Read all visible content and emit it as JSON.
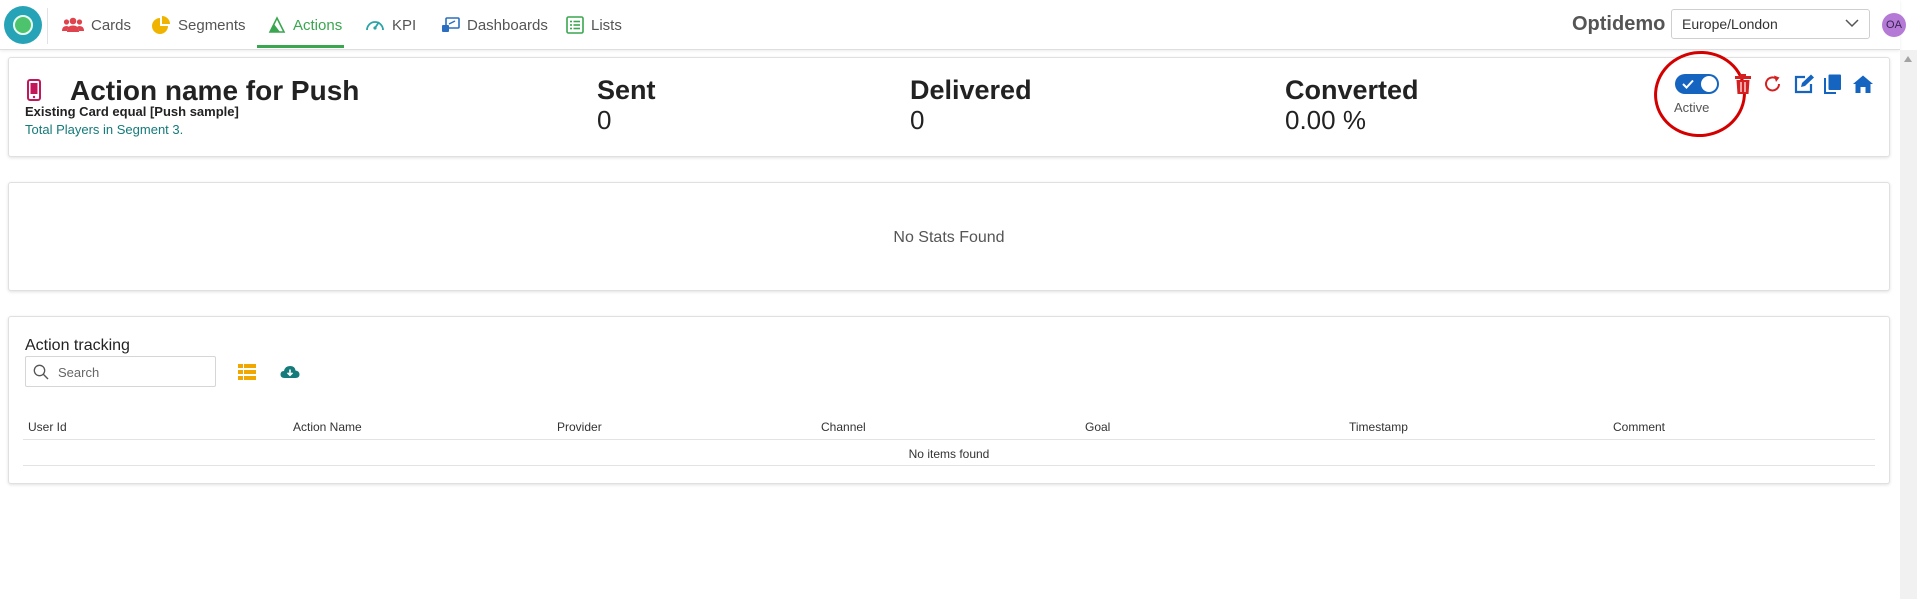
{
  "nav": {
    "items": [
      {
        "label": "Cards",
        "icon": "users-icon",
        "color": "#e0424e"
      },
      {
        "label": "Segments",
        "icon": "pie-chart-icon",
        "color": "#f0b400"
      },
      {
        "label": "Actions",
        "icon": "sail-icon",
        "color": "#3aa64f",
        "active": true
      },
      {
        "label": "KPI",
        "icon": "gauge-icon",
        "color": "#2aa4a4"
      },
      {
        "label": "Dashboards",
        "icon": "dashboard-icon",
        "color": "#2a6fbf"
      },
      {
        "label": "Lists",
        "icon": "list-icon",
        "color": "#3aa64f"
      }
    ],
    "brand": "Optidemo",
    "timezone": "Europe/London",
    "avatar_initials": "OA"
  },
  "action": {
    "title": "Action name for Push",
    "subtitle": "Existing Card equal [Push sample]",
    "segment_text": "Total Players in Segment 3.",
    "status_label": "Active",
    "status_on": true,
    "metrics": [
      {
        "label": "Sent",
        "value": "0"
      },
      {
        "label": "Delivered",
        "value": "0"
      },
      {
        "label": "Converted",
        "value": "0.00 %"
      }
    ]
  },
  "stats": {
    "empty_text": "No Stats Found"
  },
  "tracking": {
    "title": "Action tracking",
    "search_placeholder": "Search",
    "columns": [
      "User Id",
      "Action Name",
      "Provider",
      "Channel",
      "Goal",
      "Timestamp",
      "Comment"
    ],
    "empty_text": "No items found"
  },
  "colors": {
    "accent_green": "#3aa64f",
    "toggle_blue": "#1565c0",
    "delete_red": "#d42020",
    "tool_blue": "#1565c0",
    "annotation_red": "#d40000"
  }
}
